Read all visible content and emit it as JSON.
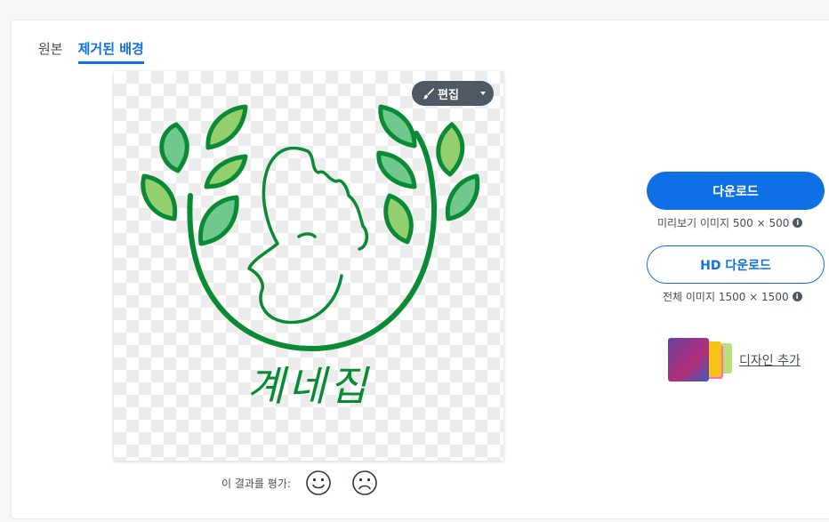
{
  "tabs": [
    {
      "label": "원본",
      "active": false
    },
    {
      "label": "제거된 배경",
      "active": true
    }
  ],
  "preview": {
    "logo_text": "계네집",
    "colors": {
      "leaf_fill": "#6fc98f",
      "leaf_fill_light": "#93cf6e",
      "leaf_stroke": "#0a8a35",
      "line": "#0a8a35"
    }
  },
  "edit_button": {
    "label": "편집",
    "icon": "brush-icon"
  },
  "rating": {
    "label": "이 결과를 평가:",
    "happy_icon": "smile-icon",
    "sad_icon": "frown-icon"
  },
  "download": {
    "label": "다운로드",
    "info": "미리보기 이미지 500 × 500"
  },
  "hd_download": {
    "label": "HD 다운로드",
    "info": "전체 이미지 1500 × 1500"
  },
  "design": {
    "label": "디자인 추가"
  },
  "colors": {
    "accent": "#0f70e6",
    "dark_button": "#4f5963"
  }
}
